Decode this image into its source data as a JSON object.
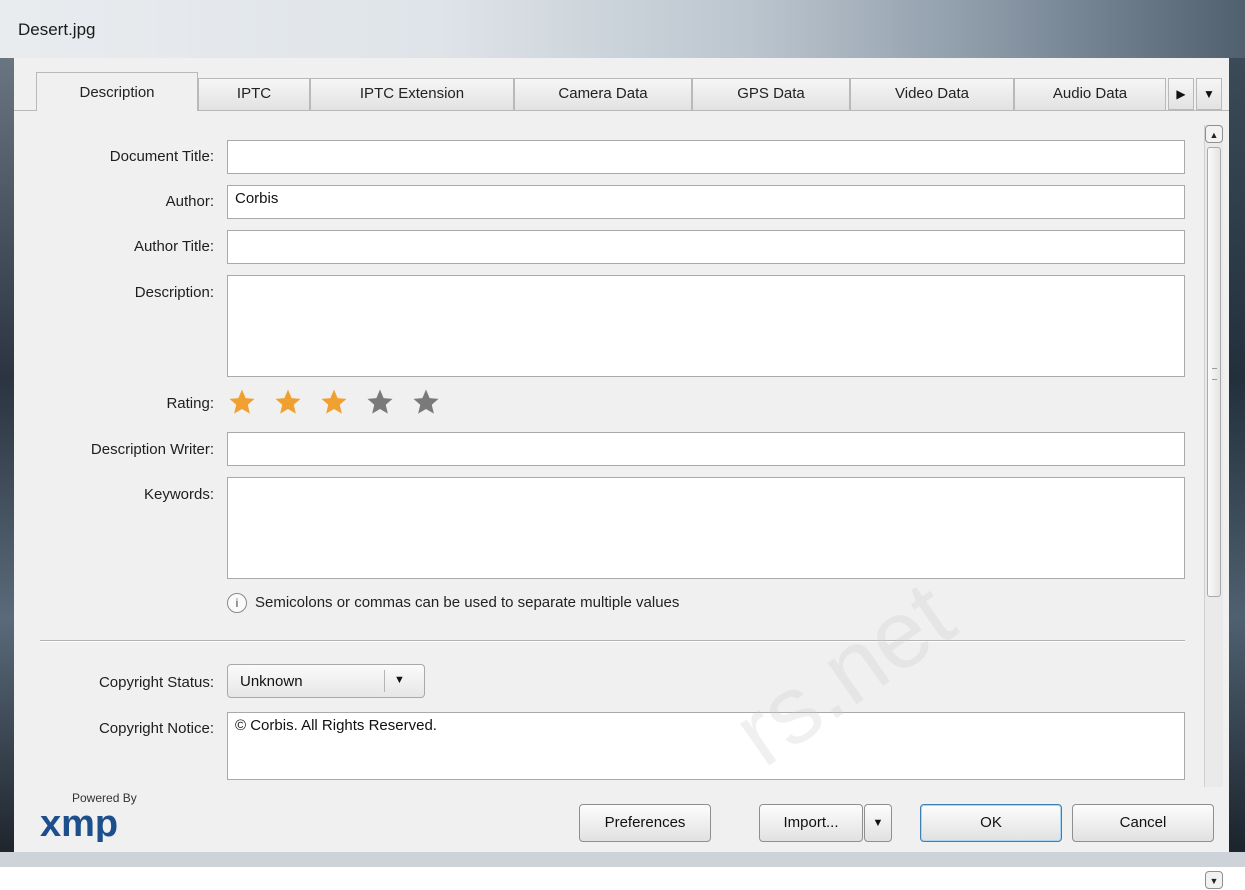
{
  "window": {
    "title": "Desert.jpg"
  },
  "tabs": [
    {
      "label": "Description",
      "active": true
    },
    {
      "label": "IPTC"
    },
    {
      "label": "IPTC Extension"
    },
    {
      "label": "Camera Data"
    },
    {
      "label": "GPS Data"
    },
    {
      "label": "Video Data"
    },
    {
      "label": "Audio Data"
    }
  ],
  "tab_nav": {
    "next_icon": "triangle-right-icon",
    "menu_icon": "chevron-down-icon"
  },
  "form": {
    "document_title": {
      "label": "Document Title:",
      "value": ""
    },
    "author": {
      "label": "Author:",
      "value": "Corbis"
    },
    "author_title": {
      "label": "Author Title:",
      "value": ""
    },
    "description": {
      "label": "Description:",
      "value": ""
    },
    "rating": {
      "label": "Rating:",
      "value": 3,
      "max": 5,
      "active_color": "#f0a030",
      "inactive_color": "#7a7a7a"
    },
    "description_writer": {
      "label": "Description Writer:",
      "value": ""
    },
    "keywords": {
      "label": "Keywords:",
      "value": ""
    },
    "keywords_hint": "Semicolons or commas can be used to separate multiple values",
    "copyright_status": {
      "label": "Copyright Status:",
      "value": "Unknown"
    },
    "copyright_notice": {
      "label": "Copyright Notice:",
      "value": "© Corbis.  All Rights Reserved."
    }
  },
  "footer": {
    "powered_by": "Powered By",
    "logo_text": "xmp",
    "preferences": "Preferences",
    "import": "Import...",
    "ok": "OK",
    "cancel": "Cancel"
  },
  "watermark": "rs.net"
}
